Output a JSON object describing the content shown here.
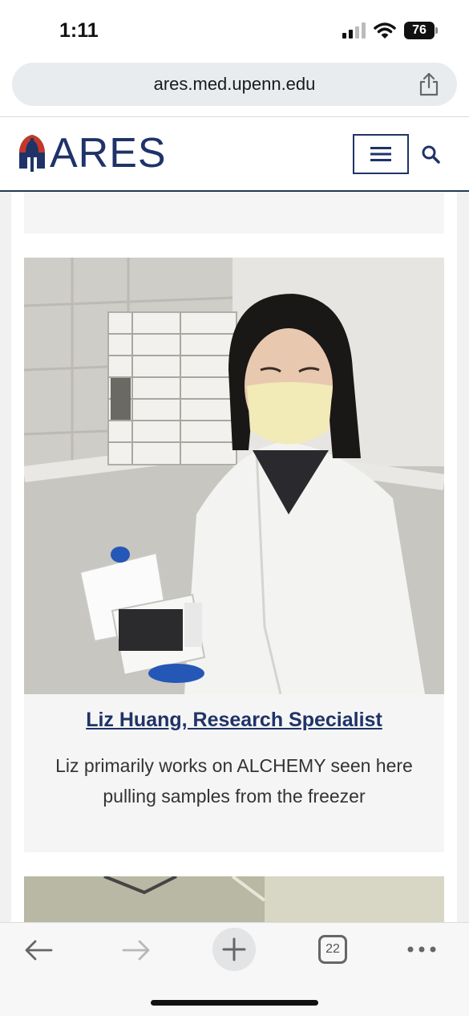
{
  "status_bar": {
    "time": "1:11",
    "battery": "76"
  },
  "browser": {
    "url": "ares.med.upenn.edu",
    "open_tabs": "22"
  },
  "site": {
    "logo_text": "ARES",
    "brand_color": "#1f3368",
    "accent_color": "#c0392b"
  },
  "card": {
    "title": "Liz Huang, Research Specialist",
    "description": "Liz primarily works on ALCHEMY seen here pulling samples from the freezer"
  },
  "icons": {
    "share": "share-icon",
    "menu": "hamburger-menu-icon",
    "search": "search-icon",
    "back": "back-arrow-icon",
    "forward": "forward-arrow-icon",
    "new_tab": "plus-icon",
    "tabs": "tabs-icon",
    "more": "more-dots-icon"
  }
}
